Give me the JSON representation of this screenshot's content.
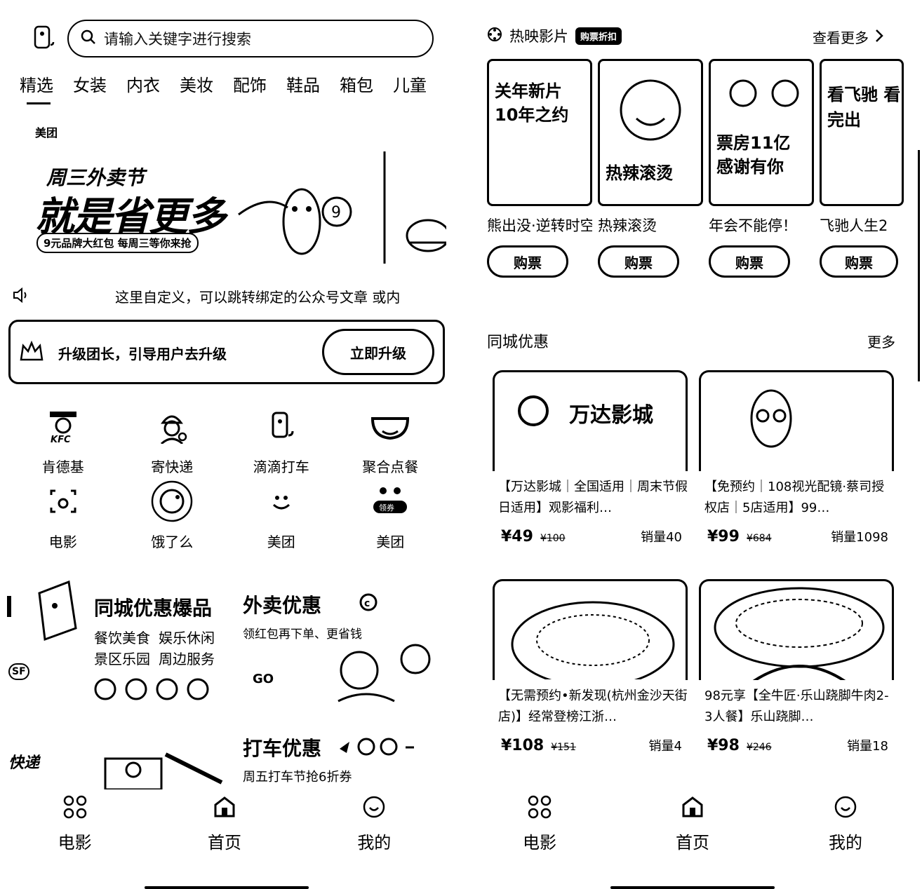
{
  "left": {
    "search": {
      "placeholder": "请输入关键字进行搜索"
    },
    "categories": [
      "精选",
      "女装",
      "内衣",
      "美妆",
      "配饰",
      "鞋品",
      "箱包",
      "儿童"
    ],
    "banner": {
      "brand": "美团",
      "line1": "周三外卖节",
      "line2": "就是省更多",
      "line3": "9元品牌大红包 每周三等你来抢"
    },
    "notice": "这里自定义，可以跳转绑定的公众号文章 或内",
    "upgrade": {
      "label": "升级团长，引导用户去升级",
      "button": "立即升级"
    },
    "grid": [
      {
        "label": "肯德基",
        "icon": "kfc-icon"
      },
      {
        "label": "寄快递",
        "icon": "courier-icon"
      },
      {
        "label": "滴滴打车",
        "icon": "didi-icon"
      },
      {
        "label": "聚合点餐",
        "icon": "bowl-icon"
      },
      {
        "label": "电影",
        "icon": "movie-icon"
      },
      {
        "label": "饿了么",
        "icon": "eleme-icon"
      },
      {
        "label": "美团",
        "icon": "meituan-icon"
      },
      {
        "label": "美团",
        "icon": "meituan-coupon-icon"
      }
    ],
    "promo": {
      "local_title": "同城优惠爆品",
      "local_tags": [
        "餐饮美食",
        "娱乐休闲",
        "景区乐园",
        "周边服务"
      ],
      "waimai_title": "外卖优惠",
      "waimai_sub": "领红包再下单、更省钱",
      "go": "GO",
      "taxi_title": "打车优惠",
      "taxi_sub": "周五打车节抢6折券",
      "express": "快递"
    },
    "tabbar": [
      {
        "label": "电影",
        "icon": "grid-icon"
      },
      {
        "label": "首页",
        "icon": "home-icon"
      },
      {
        "label": "我的",
        "icon": "smile-icon"
      }
    ]
  },
  "right": {
    "hot_title": "热映影片",
    "hot_badge": "购票折扣",
    "see_more": "查看更多",
    "movies": [
      {
        "name": "熊出没·逆转时空",
        "poster_text": "关年新片 10年之约"
      },
      {
        "name": "热辣滚烫",
        "poster_text": "热辣滚烫"
      },
      {
        "name": "年会不能停！",
        "poster_text": "票房11亿 感谢有你"
      },
      {
        "name": "飞驰人生2",
        "poster_text": "看飞驰 看完出"
      }
    ],
    "buy_label": "购票",
    "local_title": "同城优惠",
    "more": "更多",
    "deals": [
      {
        "title": "【万达影城｜全国适用｜周末节假日适用】观影福利…",
        "price": "¥49",
        "old": "¥100",
        "sales": "销量40",
        "img_text": "万达影城"
      },
      {
        "title": "【免预约｜108视光配镜·蔡司授权店｜5店适用】99…",
        "price": "¥99",
        "old": "¥684",
        "sales": "销量1098",
        "img_text": ""
      },
      {
        "title": "【无需预约•新发现(杭州金沙天街店)】经常登榜江浙…",
        "price": "¥108",
        "old": "¥151",
        "sales": "销量4",
        "img_text": ""
      },
      {
        "title": "98元享【全牛匠·乐山跷脚牛肉2-3人餐】乐山跷脚…",
        "price": "¥98",
        "old": "¥246",
        "sales": "销量18",
        "img_text": ""
      }
    ],
    "tabbar": [
      {
        "label": "电影",
        "icon": "grid-icon"
      },
      {
        "label": "首页",
        "icon": "home-icon"
      },
      {
        "label": "我的",
        "icon": "smile-icon"
      }
    ]
  }
}
